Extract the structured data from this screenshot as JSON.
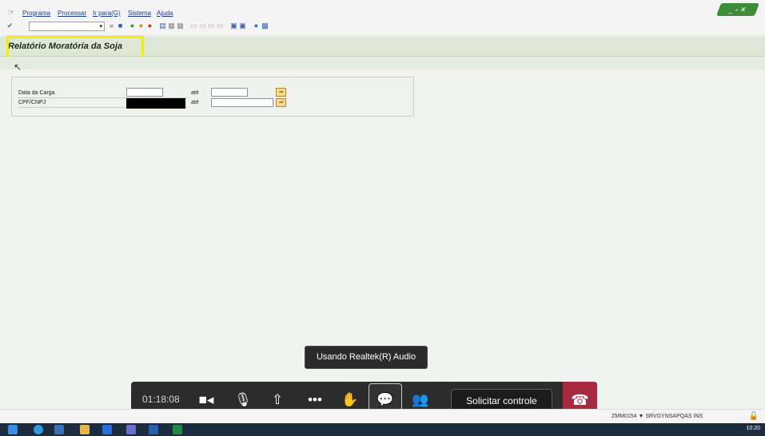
{
  "menu": {
    "items": [
      "Programa",
      "Processar",
      "Ir para(G)",
      "Sistema",
      "Ajuda"
    ]
  },
  "toolbar": {
    "command_value": "",
    "icons": [
      "check-icon",
      "save-icon",
      "back-icon",
      "exit-icon",
      "cancel-icon",
      "print-icon",
      "find-icon",
      "find-next-icon",
      "first-page-icon",
      "prev-page-icon",
      "next-page-icon",
      "last-page-icon",
      "new-session-icon",
      "shortcut-icon",
      "help-icon",
      "layout-icon"
    ]
  },
  "screen": {
    "title": "Relatório Moratória da Soja"
  },
  "selection": {
    "row1_label": "Data da Carga",
    "row2_label": "CPF/CNPJ",
    "ate_1": "até",
    "ate_2": "até",
    "row1_from": "",
    "row1_to": "",
    "row2_to": ""
  },
  "teams": {
    "tooltip": "Usando Realtek(R) Audio",
    "timer": "01:18:08",
    "request_control": "Solicitar controle"
  },
  "status": {
    "text": "ZMM0154 ▼  SRVGYNSAPQAS  INS"
  },
  "taskbar": {
    "clock": "10:20"
  },
  "colors": {
    "title_highlight": "#f4ee00",
    "hangup": "#a72a40",
    "sap_title_bg": "#dde8d6"
  }
}
